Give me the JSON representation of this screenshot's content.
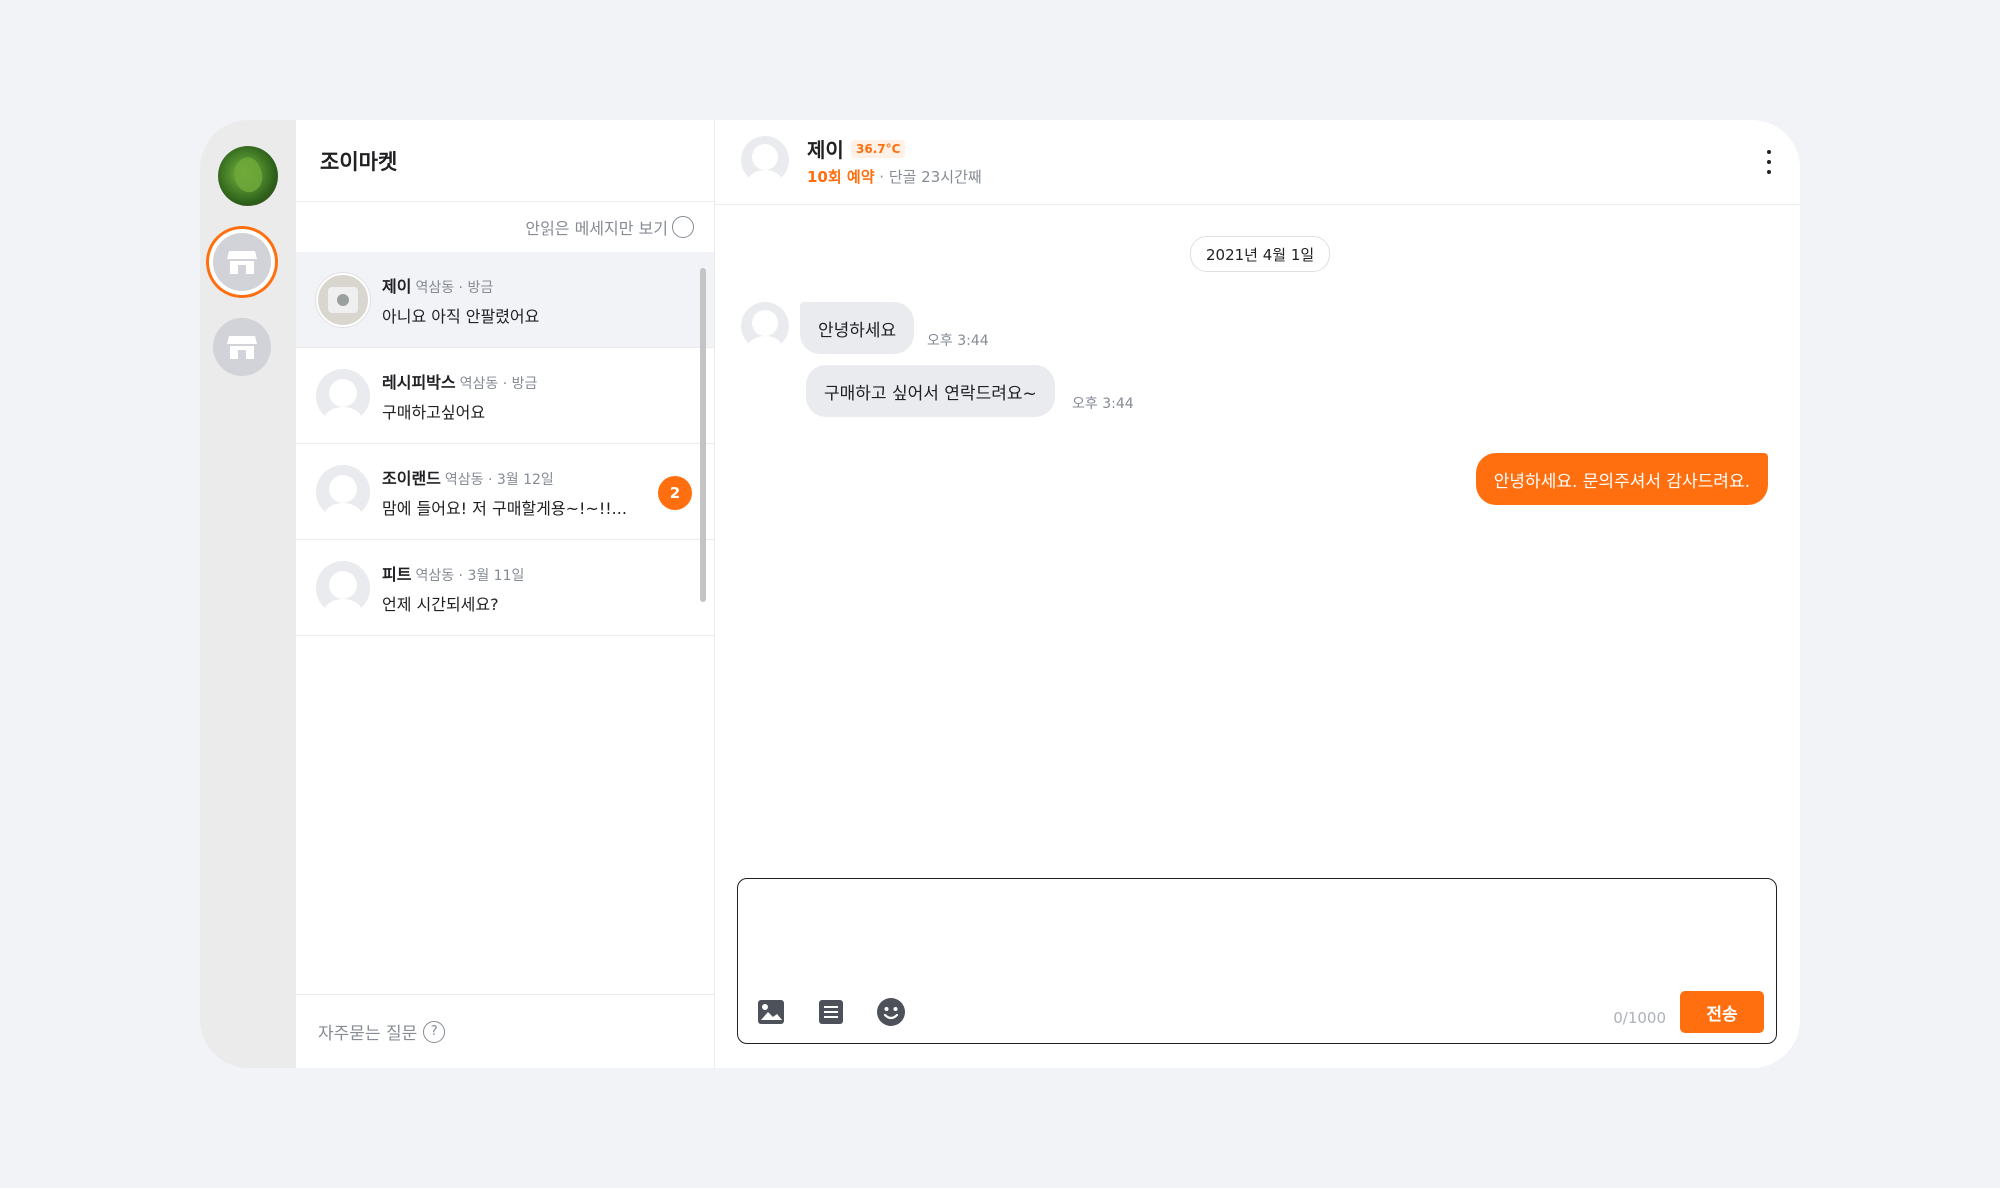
{
  "sidebar": {
    "profile_icon": "profile-photo",
    "stores": [
      "store-icon",
      "store-icon"
    ]
  },
  "list": {
    "title": "조이마켓",
    "filter_label": "안읽은 메세지만 보기",
    "items": [
      {
        "name": "제이",
        "meta": "역삼동 · 방금",
        "preview": "아니요 아직 안팔렸어요",
        "selected": true
      },
      {
        "name": "레시피박스",
        "meta": "역삼동 · 방금",
        "preview": "구매하고싶어요"
      },
      {
        "name": "조이랜드",
        "meta": "역삼동 · 3월 12일",
        "preview": "맘에 들어요! 저 구매할게용~!~!!...",
        "unread": "2"
      },
      {
        "name": "피트",
        "meta": "역삼동 · 3월 11일",
        "preview": "언제 시간되세요?"
      }
    ],
    "faq_label": "자주묻는 질문",
    "faq_icon_text": "?"
  },
  "chat": {
    "peer_name": "제이",
    "temperature": "36.7°C",
    "reservations": "10회 예약",
    "sub_info": "· 단골 23시간째",
    "date": "2021년 4월 1일",
    "messages": [
      {
        "text": "안녕하세요",
        "time": "오후 3:44",
        "from": "peer"
      },
      {
        "text": "구매하고 싶어서 연락드려요~",
        "time": "오후 3:44",
        "from": "peer"
      },
      {
        "text": "안녕하세요. 문의주셔서 감사드려요.",
        "from": "me"
      }
    ],
    "composer": {
      "placeholder": "",
      "counter": "0/1000",
      "send_label": "전송"
    }
  },
  "colors": {
    "accent": "#ff6f0f",
    "rail": "#ebebeb",
    "page_bg": "#f2f3f6"
  }
}
